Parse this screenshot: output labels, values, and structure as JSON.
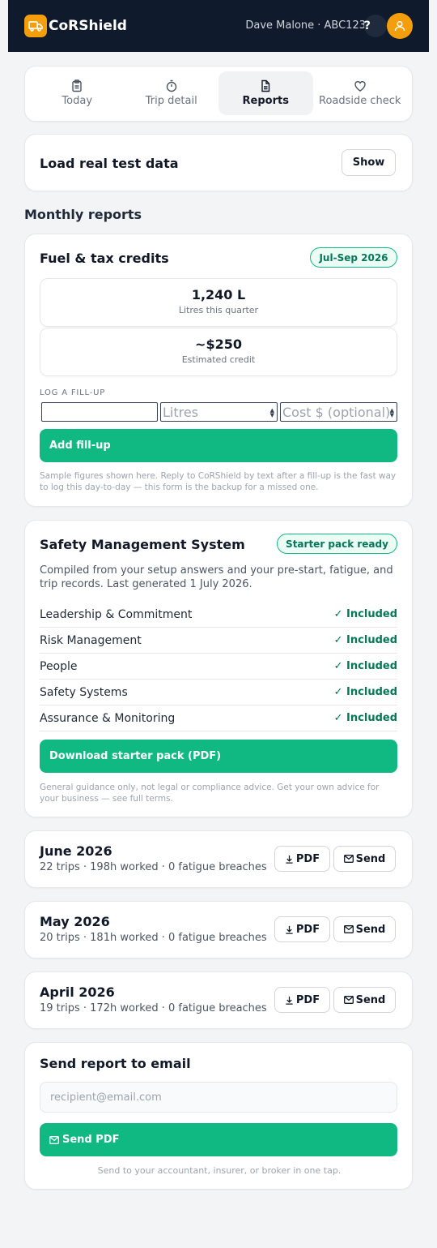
{
  "app": {
    "brand": "CoRShield",
    "user_label": "Dave Malone · ABC123",
    "help_label": "?"
  },
  "tabs": [
    {
      "label": "Today",
      "icon": "clipboard-icon",
      "active": false
    },
    {
      "label": "Trip detail",
      "icon": "stopwatch-icon",
      "active": false
    },
    {
      "label": "Reports",
      "icon": "document-icon",
      "active": true
    },
    {
      "label": "Roadside check",
      "icon": "heart-icon",
      "active": false
    }
  ],
  "test_data": {
    "title": "Load real test data",
    "button": "Show"
  },
  "monthly_heading": "Monthly reports",
  "fuel": {
    "title": "Fuel & tax credits",
    "period": "Jul-Sep 2026",
    "litres_value": "1,240 L",
    "litres_label": "Litres this quarter",
    "credit_value": "~$250",
    "credit_label": "Estimated credit",
    "log_label": "LOG A FILL-UP",
    "date_value": "",
    "litres_placeholder": "Litres",
    "cost_placeholder": "Cost $ (optional)",
    "add_button": "Add fill-up",
    "note": "Sample figures shown here. Reply to CoRShield by text after a fill-up is the fast way to log this day-to-day — this form is the backup for a missed one."
  },
  "sms": {
    "title": "Safety Management System",
    "badge": "Starter pack ready",
    "description": "Compiled from your setup answers and your pre-start, fatigue, and trip records. Last generated 1 July 2026.",
    "pillars": [
      {
        "name": "Leadership & Commitment",
        "status": "✓ Included"
      },
      {
        "name": "Risk Management",
        "status": "✓ Included"
      },
      {
        "name": "People",
        "status": "✓ Included"
      },
      {
        "name": "Safety Systems",
        "status": "✓ Included"
      },
      {
        "name": "Assurance & Monitoring",
        "status": "✓ Included"
      }
    ],
    "download_button": "Download starter pack (PDF)",
    "disclaimer": "General guidance only, not legal or compliance advice. Get your own advice for your business — see full terms."
  },
  "months": [
    {
      "title": "June 2026",
      "summary": "22 trips · 198h worked · 0 fatigue breaches",
      "pdf": "PDF",
      "send": "Send"
    },
    {
      "title": "May 2026",
      "summary": "20 trips · 181h worked · 0 fatigue breaches",
      "pdf": "PDF",
      "send": "Send"
    },
    {
      "title": "April 2026",
      "summary": "19 trips · 172h worked · 0 fatigue breaches",
      "pdf": "PDF",
      "send": "Send"
    }
  ],
  "email": {
    "title": "Send report to email",
    "placeholder": "recipient@email.com",
    "button": "Send PDF",
    "note": "Send to your accountant, insurer, or broker in one tap."
  },
  "colors": {
    "accent_green": "#10b981",
    "brand_amber": "#f59e0b",
    "header_navy": "#0f1b2d"
  }
}
